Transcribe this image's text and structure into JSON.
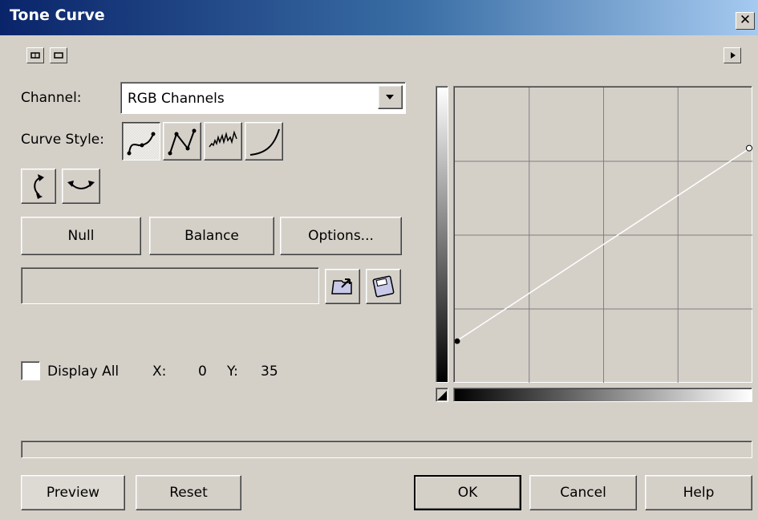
{
  "window": {
    "title": "Tone Curve"
  },
  "channel": {
    "label": "Channel:",
    "value": "RGB Channels"
  },
  "curve_style": {
    "label": "Curve Style:"
  },
  "buttons": {
    "null": "Null",
    "balance": "Balance",
    "options": "Options..."
  },
  "display_all": {
    "label": "Display All",
    "checked": false
  },
  "coords": {
    "x_label": "X:",
    "x_value": "0",
    "y_label": "Y:",
    "y_value": "35"
  },
  "footer": {
    "preview": "Preview",
    "reset": "Reset",
    "ok": "OK",
    "cancel": "Cancel",
    "help": "Help"
  },
  "curve": {
    "start": [
      0,
      35
    ],
    "end": [
      255,
      204
    ]
  },
  "colors": {
    "title_start": "#0a246a",
    "title_end": "#a6caf0",
    "panel": "#d4d0c8",
    "graph_bg": "#d4d0c8"
  }
}
